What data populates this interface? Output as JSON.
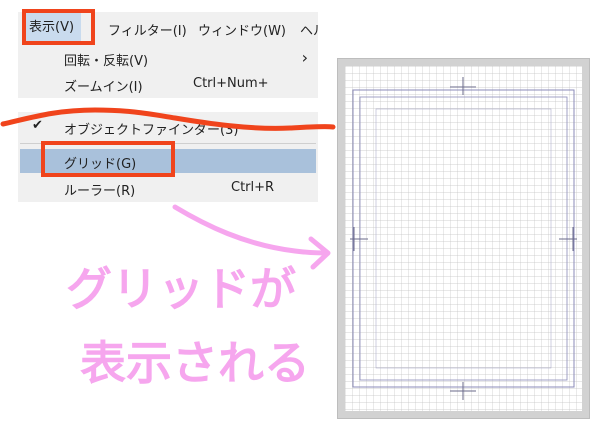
{
  "menubar": {
    "items": [
      "表示(V)",
      "フィルター(I)",
      "ウィンドウ(W)",
      "ヘル"
    ]
  },
  "menu_top": {
    "items": [
      {
        "label": "回転・反転(V)",
        "shortcut": "",
        "submenu": true
      },
      {
        "label": "ズームイン(I)",
        "shortcut": "Ctrl+Num+"
      }
    ]
  },
  "menu_bottom": {
    "items": [
      {
        "label": "オブジェクトファインダー(3)",
        "shortcut": "",
        "checked": true
      },
      {
        "label": "グリッド(G)",
        "shortcut": "",
        "highlighted": true
      },
      {
        "label": "ルーラー(R)",
        "shortcut": "Ctrl+R"
      }
    ]
  },
  "annotation": {
    "line1": "グリッドが",
    "line2": "表示される"
  },
  "colors": {
    "highlight_box": "#f0441c",
    "annotation": "#f6a6ee",
    "menu_bg": "#f0f0f0",
    "menu_hover": "#a9c1db"
  },
  "icons": [
    "checkmark-icon",
    "chevron-right-icon",
    "arrow-icon"
  ]
}
